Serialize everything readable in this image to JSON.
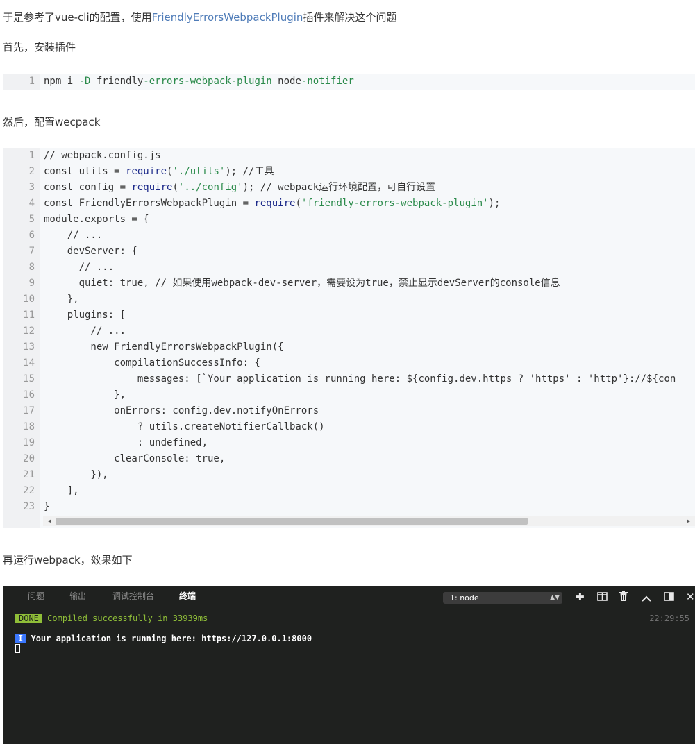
{
  "paragraphs": {
    "p1_prefix": "于是参考了vue-cli的配置，使用",
    "p1_link": "FriendlyErrorsWebpackPlugin",
    "p1_suffix": "插件来解决这个问题",
    "p2": "首先，安装插件",
    "p3": "然后，配置wecpack",
    "p4": "再运行webpack，效果如下"
  },
  "code1": {
    "line_numbers": [
      "1"
    ],
    "lines": [
      [
        {
          "t": "npm i ",
          "c": "#333333"
        },
        {
          "t": "-D",
          "c": "#2a8a4a"
        },
        {
          "t": " friendly",
          "c": "#333333"
        },
        {
          "t": "-errors-webpack-plugin",
          "c": "#2a8a4a"
        },
        {
          "t": " node",
          "c": "#333333"
        },
        {
          "t": "-notifier",
          "c": "#2a8a4a"
        }
      ]
    ]
  },
  "code2": {
    "line_numbers": [
      "1",
      "2",
      "3",
      "4",
      "5",
      "6",
      "7",
      "8",
      "9",
      "10",
      "11",
      "12",
      "13",
      "14",
      "15",
      "16",
      "17",
      "18",
      "19",
      "20",
      "21",
      "22",
      "23"
    ],
    "lines": [
      [
        {
          "t": "// webpack.config.js",
          "c": "#333333"
        }
      ],
      [
        {
          "t": "const utils = ",
          "c": "#333333"
        },
        {
          "t": "require",
          "c": "#1c2a8a"
        },
        {
          "t": "(",
          "c": "#333333"
        },
        {
          "t": "'./utils'",
          "c": "#2a8a4a"
        },
        {
          "t": "); //工具",
          "c": "#333333"
        }
      ],
      [
        {
          "t": "const config = ",
          "c": "#333333"
        },
        {
          "t": "require",
          "c": "#1c2a8a"
        },
        {
          "t": "(",
          "c": "#333333"
        },
        {
          "t": "'../config'",
          "c": "#2a8a4a"
        },
        {
          "t": "); // webpack运行环境配置，可自行设置",
          "c": "#333333"
        }
      ],
      [
        {
          "t": "const FriendlyErrorsWebpackPlugin = ",
          "c": "#333333"
        },
        {
          "t": "require",
          "c": "#1c2a8a"
        },
        {
          "t": "(",
          "c": "#333333"
        },
        {
          "t": "'friendly-errors-webpack-plugin'",
          "c": "#2a8a4a"
        },
        {
          "t": ");",
          "c": "#333333"
        }
      ],
      [
        {
          "t": "module.exports = {",
          "c": "#333333"
        }
      ],
      [
        {
          "t": "    // ...",
          "c": "#333333"
        }
      ],
      [
        {
          "t": "    devServer: {",
          "c": "#333333"
        }
      ],
      [
        {
          "t": "      // ...",
          "c": "#333333"
        }
      ],
      [
        {
          "t": "      quiet: true, // 如果使用webpack-dev-server，需要设为true，禁止显示devServer的console信息",
          "c": "#333333"
        }
      ],
      [
        {
          "t": "    },",
          "c": "#333333"
        }
      ],
      [
        {
          "t": "    plugins: [",
          "c": "#333333"
        }
      ],
      [
        {
          "t": "        // ...",
          "c": "#333333"
        }
      ],
      [
        {
          "t": "        new FriendlyErrorsWebpackPlugin({",
          "c": "#333333"
        }
      ],
      [
        {
          "t": "            compilationSuccessInfo: {",
          "c": "#333333"
        }
      ],
      [
        {
          "t": "                messages: [`Your application is running here: ${config.dev.https ? 'https' : 'http'}://${con",
          "c": "#333333"
        }
      ],
      [
        {
          "t": "            },",
          "c": "#333333"
        }
      ],
      [
        {
          "t": "            onErrors: config.dev.notifyOnErrors",
          "c": "#333333"
        }
      ],
      [
        {
          "t": "                ? utils.createNotifierCallback()",
          "c": "#333333"
        }
      ],
      [
        {
          "t": "                : undefined,",
          "c": "#333333"
        }
      ],
      [
        {
          "t": "            clearConsole: true,",
          "c": "#333333"
        }
      ],
      [
        {
          "t": "        }),",
          "c": "#333333"
        }
      ],
      [
        {
          "t": "    ],",
          "c": "#333333"
        }
      ],
      [
        {
          "t": "}",
          "c": "#333333"
        }
      ]
    ]
  },
  "terminal": {
    "tabs": [
      "问题",
      "输出",
      "调试控制台",
      "终端"
    ],
    "active_tab": "终端",
    "selector": "1: node",
    "icons": {
      "add": "plus-icon",
      "split": "split-icon",
      "delete": "trash-icon",
      "maximize": "chevron-up-icon",
      "panel": "panel-icon",
      "close": "close-icon"
    },
    "done_badge": "DONE",
    "done_message": "Compiled successfully in 33939ms",
    "time": "22:29:55",
    "info_badge": "I",
    "info_message": "Your application is running here: https://127.0.0.1:8000",
    "colors": {
      "background": "#1f211f",
      "done_badge": "#8fbe38",
      "info_badge": "#3b78ff"
    }
  }
}
